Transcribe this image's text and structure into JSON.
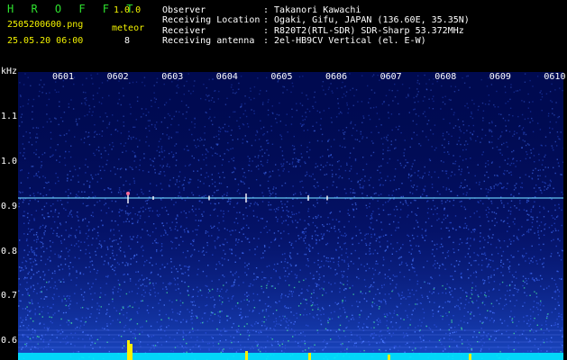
{
  "app": {
    "title": "H R O F F T",
    "version": "1.0.0"
  },
  "file": {
    "name": "2505200600.png",
    "datetime": "25.05.20 06:00"
  },
  "meteor": {
    "label": "meteor",
    "count": "8"
  },
  "info": [
    {
      "label": "Observer",
      "value": ": Takanori Kawachi"
    },
    {
      "label": "Receiving Location",
      "value": ": Ogaki, Gifu, JAPAN (136.60E, 35.35N)"
    },
    {
      "label": "Receiver",
      "value": ": R820T2(RTL-SDR) SDR-Sharp 53.372MHz"
    },
    {
      "label": "Receiving antenna",
      "value": ": 2el-HB9CV Vertical (el. E-W)"
    }
  ],
  "spectrogram": {
    "y_unit": "kHz",
    "y_ticks": [
      "1.1",
      "1.0",
      "0.9",
      "0.8",
      "0.7",
      "0.6"
    ],
    "x_ticks": [
      "0601",
      "0602",
      "0603",
      "0604",
      "0605",
      "0606",
      "0607",
      "0608",
      "0609",
      "0610"
    ],
    "carrier_khz": 0.92,
    "colors": {
      "background": "#000a50",
      "noise": "#2a4fd6",
      "carrier": "#6fd8ff",
      "echo": "#ffffff",
      "hot": "#ffee00",
      "band": "#00e5ff"
    }
  }
}
